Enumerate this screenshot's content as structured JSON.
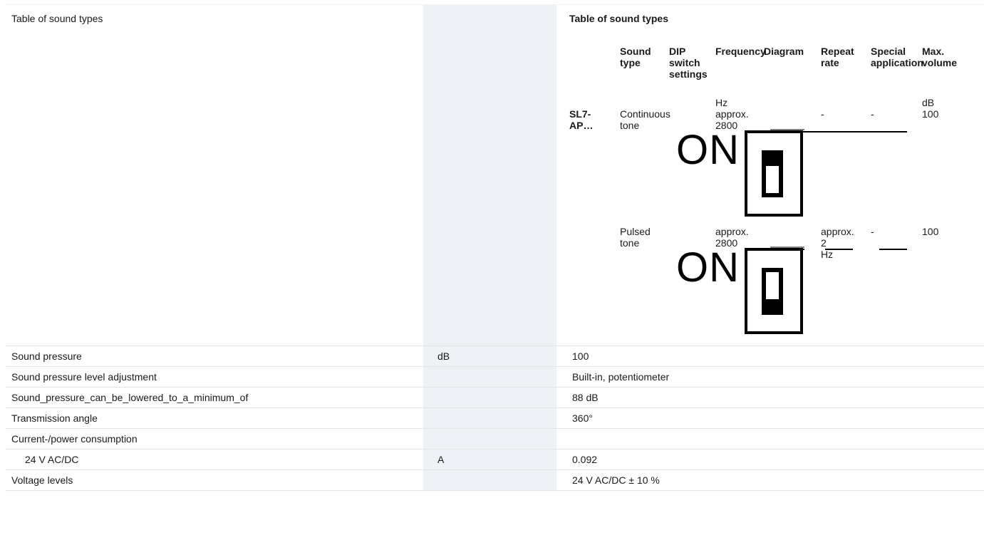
{
  "rows": {
    "sound_types": {
      "label": "Table of sound types"
    },
    "sound_pressure": {
      "label": "Sound pressure",
      "unit": "dB",
      "value": "100"
    },
    "spl_adjust": {
      "label": "Sound pressure level adjustment",
      "unit": "",
      "value": "Built-in, potentiometer"
    },
    "lowered_min": {
      "label": "Sound_pressure_can_be_lowered_to_a_minimum_of",
      "unit": "",
      "value": "88 dB"
    },
    "angle": {
      "label": "Transmission angle",
      "unit": "",
      "value": "360°"
    },
    "consumption": {
      "label": "Current-/power consumption",
      "unit": "",
      "value": ""
    },
    "consumption_24v": {
      "label": "24 V AC/DC",
      "unit": "A",
      "value": "0.092"
    },
    "voltage": {
      "label": "Voltage levels",
      "unit": "",
      "value": "24 V AC/DC ± 10 %"
    }
  },
  "sound_table": {
    "title": "Table of sound types",
    "headers": {
      "sound_type": [
        "Sound",
        "type"
      ],
      "dip": [
        "DIP",
        "switch",
        "settings"
      ],
      "frequency": "Frequency",
      "diagram": "Diagram",
      "repeat": [
        "Repeat",
        "rate"
      ],
      "special": [
        "Special",
        "application"
      ],
      "max": [
        "Max.",
        "volume"
      ]
    },
    "units": {
      "frequency": "Hz",
      "max": "dB"
    },
    "model": [
      "SL7-",
      "AP…"
    ],
    "rows": [
      {
        "type": [
          "Continuous",
          "tone"
        ],
        "dip": "ON",
        "freq": [
          "approx.",
          "2800"
        ],
        "repeat": [
          "-"
        ],
        "special": "-",
        "max": "100"
      },
      {
        "type": [
          "Pulsed",
          "tone"
        ],
        "dip": "ON",
        "freq": [
          "approx.",
          "2800"
        ],
        "repeat": [
          "approx.",
          "2",
          "Hz"
        ],
        "special": "-",
        "max": "100"
      }
    ]
  }
}
